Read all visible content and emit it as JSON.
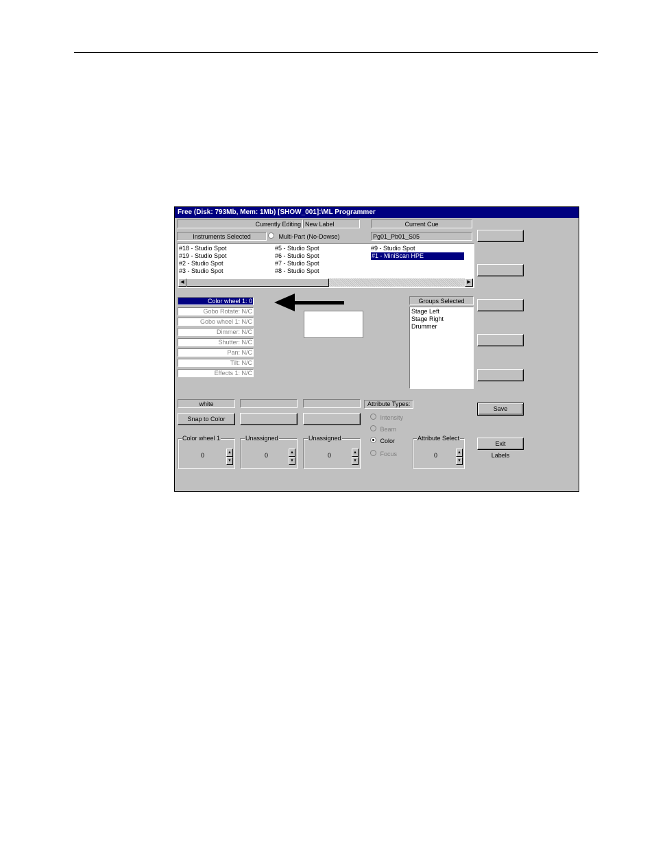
{
  "window": {
    "title": "Free (Disk: 793Mb, Mem: 1Mb)    [SHOW_001]:\\ML Programmer"
  },
  "header": {
    "currently_editing_label": "Currently Editing",
    "currently_editing_value": "New Label",
    "current_cue_label": "Current Cue",
    "current_cue_value": "Pg01_Pb01_S05",
    "instruments_selected_label": "Instruments Selected",
    "multipart_label": "Multi-Part (No-Dowse)"
  },
  "instruments": {
    "col1": [
      "#18 - Studio Spot",
      "#19 - Studio Spot",
      "#2 - Studio Spot",
      "#3 - Studio Spot"
    ],
    "col2": [
      "#5 - Studio Spot",
      "#6 - Studio Spot",
      "#7 - Studio Spot",
      "#8 - Studio Spot"
    ],
    "col3": [
      "#9 - Studio Spot",
      "#1 - MiniScan HPE"
    ]
  },
  "attributes": [
    "Color wheel 1: 0",
    "Gobo Rotate: N/C",
    "Gobo wheel 1: N/C",
    "Dimmer: N/C",
    "Shutter: N/C",
    "Pan: N/C",
    "Tilt: N/C",
    "Effects 1: N/C"
  ],
  "groups": {
    "title": "Groups Selected",
    "items": [
      "Stage Left",
      "Stage Right",
      "Drummer"
    ]
  },
  "controls": {
    "color_value": "white",
    "snap_button": "Snap to Color",
    "attribute_types_label": "Attribute Types:",
    "attribute_types": [
      "Intensity",
      "Beam",
      "Color",
      "Focus"
    ],
    "attribute_types_selected": "Color",
    "spinners": [
      {
        "title": "Color wheel 1",
        "value": "0"
      },
      {
        "title": "Unassigned",
        "value": "0"
      },
      {
        "title": "Unassigned",
        "value": "0"
      },
      {
        "title": "Attribute Select",
        "value": "0"
      }
    ]
  },
  "right_buttons": {
    "save": "Save",
    "exit": "Exit",
    "labels": "Labels"
  }
}
